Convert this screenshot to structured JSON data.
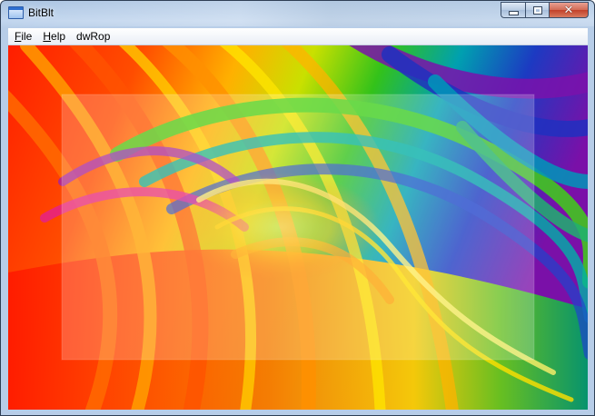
{
  "window": {
    "title": "BitBlt",
    "icon": "window-app-icon",
    "caption_buttons": [
      "minimize",
      "maximize",
      "close"
    ]
  },
  "menu": {
    "items": [
      {
        "label": "File",
        "mnemonic": "F",
        "rest": "ile"
      },
      {
        "label": "Help",
        "mnemonic": "H",
        "rest": "elp"
      },
      {
        "label": "dwRop",
        "mnemonic": "",
        "rest": "dwRop"
      }
    ]
  },
  "canvas": {
    "image": "rainbow-spiral-swirl",
    "overlay": "semi-transparent-rectangle",
    "colors": {
      "red": "#ff2a00",
      "orange": "#ff8a00",
      "yellow": "#ffe000",
      "green": "#37c21c",
      "cyan": "#00a7b4",
      "blue": "#2340c8",
      "purple": "#8a1ab0",
      "magenta": "#e01e9a"
    }
  }
}
